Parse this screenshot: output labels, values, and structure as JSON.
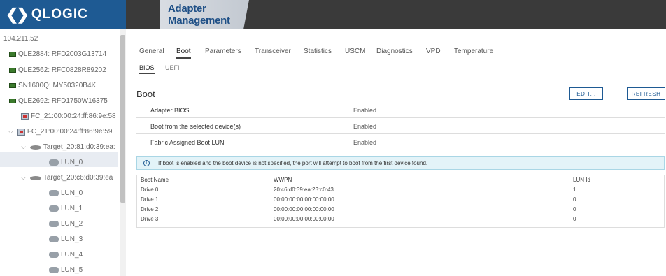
{
  "header": {
    "logo_mark": "❮❯",
    "logo_text": "QLOGIC",
    "app_title": "Adapter Management"
  },
  "sidebar": {
    "host": "104.211.52",
    "adapters": [
      {
        "label": "QLE2884: RFD2003G13714"
      },
      {
        "label": "QLE2562: RFC0828R89202"
      },
      {
        "label": "SN1600Q: MY50320B4K"
      },
      {
        "label": "QLE2692: RFD1750W16375"
      }
    ],
    "ports": [
      {
        "label": "FC_21:00:00:24:ff:86:9e:58"
      },
      {
        "label": "FC_21:00:00:24:ff:86:9e:59"
      }
    ],
    "targets": [
      {
        "label": "Target_20:81:d0:39:ea:"
      },
      {
        "label": "Target_20:c6:d0:39:ea"
      }
    ],
    "luns_a": [
      "LUN_0"
    ],
    "luns_b": [
      "LUN_0",
      "LUN_1",
      "LUN_2",
      "LUN_3",
      "LUN_4",
      "LUN_5"
    ]
  },
  "tabs": [
    "General",
    "Boot",
    "Parameters",
    "Transceiver",
    "Statistics",
    "USCM",
    "Diagnostics",
    "VPD",
    "Temperature"
  ],
  "active_tab": "Boot",
  "subtabs": [
    "BIOS",
    "UEFI"
  ],
  "boot": {
    "title": "Boot",
    "edit_label": "EDIT...",
    "refresh_label": "REFRESH",
    "settings": [
      {
        "label": "Adapter BIOS",
        "value": "Enabled"
      },
      {
        "label": "Boot from the selected device(s)",
        "value": "Enabled"
      },
      {
        "label": "Fabric Assigned Boot LUN",
        "value": "Enabled"
      }
    ],
    "info_icon": "i",
    "info_text": "If boot is enabled and the boot device is not specified, the port will attempt to boot from the first device found."
  },
  "table": {
    "headers": [
      "Boot Name",
      "WWPN",
      "LUN Id"
    ],
    "rows": [
      [
        "Drive 0",
        "20:c6:d0:39:ea:23:c0:43",
        "1"
      ],
      [
        "Drive 1",
        "00:00:00:00:00:00:00:00",
        "0"
      ],
      [
        "Drive 2",
        "00:00:00:00:00:00:00:00",
        "0"
      ],
      [
        "Drive 3",
        "00:00:00:00:00:00:00:00",
        "0"
      ]
    ]
  },
  "colors": {
    "brand": "#1e5a93",
    "header_bg": "#3a3a3a",
    "info_bg": "#e3f3f8"
  }
}
